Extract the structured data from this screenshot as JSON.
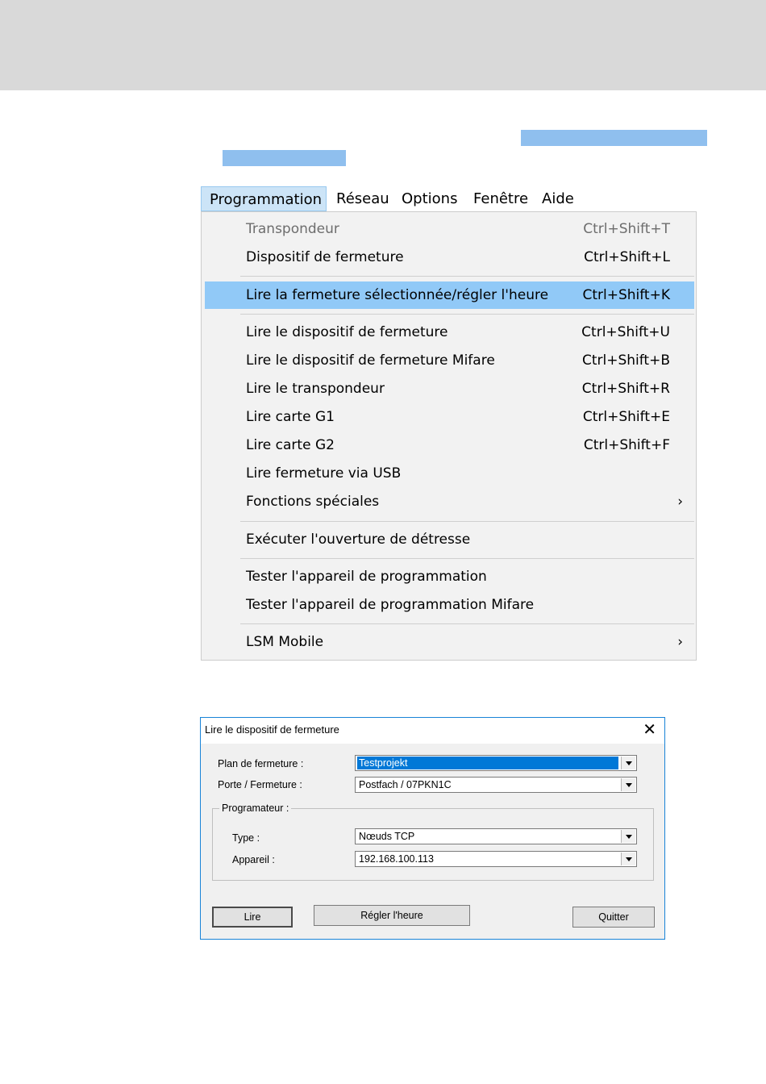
{
  "menu": {
    "bar": [
      {
        "label": "Programmation",
        "active": true
      },
      {
        "label": "Réseau"
      },
      {
        "label": "Options"
      },
      {
        "label": "Fenêtre"
      },
      {
        "label": "Aide"
      }
    ],
    "items": [
      {
        "label": "Transpondeur",
        "shortcut": "Ctrl+Shift+T",
        "disabled": true
      },
      {
        "label": "Dispositif de fermeture",
        "shortcut": "Ctrl+Shift+L"
      },
      {
        "label": "Lire la fermeture sélectionnée/régler l'heure",
        "shortcut": "Ctrl+Shift+K",
        "selected": true
      },
      {
        "label": "Lire le dispositif de fermeture",
        "shortcut": "Ctrl+Shift+U"
      },
      {
        "label": "Lire le dispositif de fermeture Mifare",
        "shortcut": "Ctrl+Shift+B"
      },
      {
        "label": "Lire le transpondeur",
        "shortcut": "Ctrl+Shift+R"
      },
      {
        "label": "Lire carte G1",
        "shortcut": "Ctrl+Shift+E"
      },
      {
        "label": "Lire carte G2",
        "shortcut": "Ctrl+Shift+F"
      },
      {
        "label": "Lire fermeture via USB",
        "shortcut": ""
      },
      {
        "label": "Fonctions spéciales",
        "submenu": "›"
      },
      {
        "label": "Exécuter l'ouverture de détresse",
        "shortcut": ""
      },
      {
        "label": "Tester l'appareil de programmation",
        "shortcut": ""
      },
      {
        "label": "Tester l'appareil de programmation Mifare",
        "shortcut": ""
      },
      {
        "label": "LSM Mobile",
        "submenu": "›"
      }
    ]
  },
  "dialog": {
    "title": "Lire le dispositif de fermeture",
    "close": "✕",
    "plan_label": "Plan de fermeture :",
    "plan_value": "Testprojekt",
    "door_label": "Porte / Fermeture :",
    "door_value": "Postfach / 07PKN1C",
    "group_label": "Programateur :",
    "type_label": "Type :",
    "type_value": "Nœuds TCP",
    "device_label": "Appareil :",
    "device_value": "192.168.100.113",
    "btn_read": "Lire",
    "btn_time": "Régler l'heure",
    "btn_quit": "Quitter"
  }
}
